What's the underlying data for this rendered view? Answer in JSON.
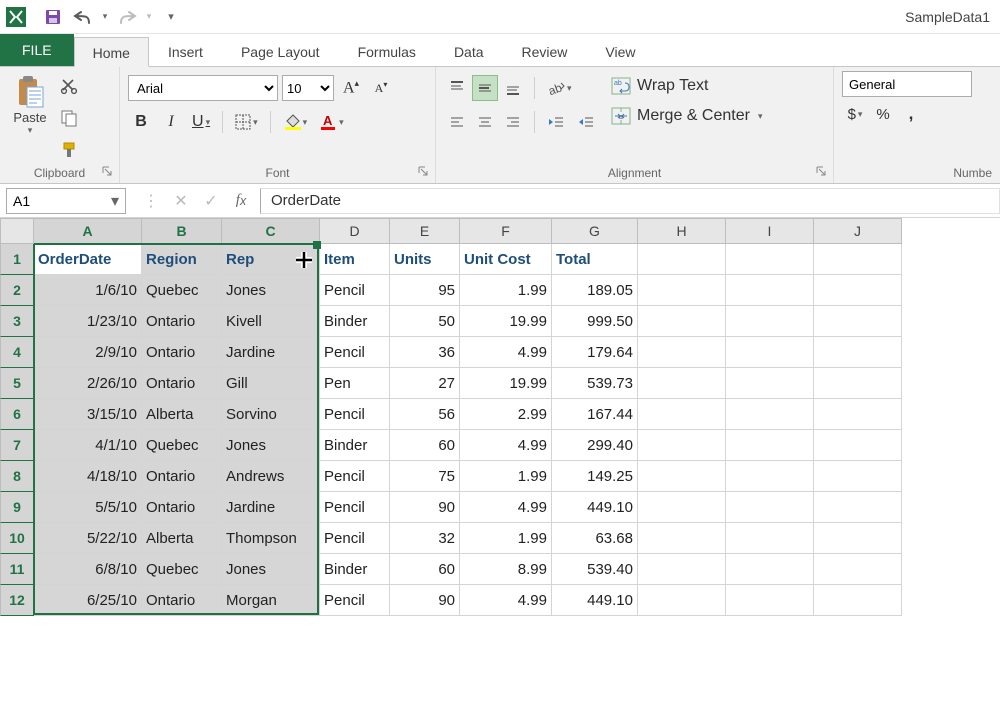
{
  "app": {
    "doc_title": "SampleData1"
  },
  "qat": {
    "save": "save-icon",
    "undo": "undo-icon",
    "redo": "redo-icon"
  },
  "tabs": {
    "file": "FILE",
    "items": [
      "Home",
      "Insert",
      "Page Layout",
      "Formulas",
      "Data",
      "Review",
      "View"
    ],
    "active": 0
  },
  "ribbon": {
    "clipboard": {
      "label": "Clipboard",
      "paste": "Paste"
    },
    "font": {
      "label": "Font",
      "name": "Arial",
      "size": "10",
      "bold": "B",
      "italic": "I",
      "underline": "U"
    },
    "alignment": {
      "label": "Alignment",
      "wrap": "Wrap Text",
      "merge": "Merge & Center"
    },
    "number": {
      "label": "Numbe",
      "format": "General",
      "currency": "$",
      "percent": "%",
      "comma": ","
    }
  },
  "fx": {
    "namebox": "A1",
    "formula": "OrderDate"
  },
  "grid": {
    "columns": [
      {
        "letter": "A",
        "w": 108
      },
      {
        "letter": "B",
        "w": 80
      },
      {
        "letter": "C",
        "w": 98
      },
      {
        "letter": "D",
        "w": 70
      },
      {
        "letter": "E",
        "w": 70
      },
      {
        "letter": "F",
        "w": 92
      },
      {
        "letter": "G",
        "w": 86
      },
      {
        "letter": "H",
        "w": 88
      },
      {
        "letter": "I",
        "w": 88
      },
      {
        "letter": "J",
        "w": 88
      }
    ],
    "selected_cols": [
      0,
      1,
      2
    ],
    "headers": [
      "OrderDate",
      "Region",
      "Rep",
      "Item",
      "Units",
      "Unit Cost",
      "Total"
    ],
    "numeric_cols": [
      0,
      4,
      5,
      6
    ],
    "rows": [
      [
        "1/6/10",
        "Quebec",
        "Jones",
        "Pencil",
        "95",
        "1.99",
        "189.05"
      ],
      [
        "1/23/10",
        "Ontario",
        "Kivell",
        "Binder",
        "50",
        "19.99",
        "999.50"
      ],
      [
        "2/9/10",
        "Ontario",
        "Jardine",
        "Pencil",
        "36",
        "4.99",
        "179.64"
      ],
      [
        "2/26/10",
        "Ontario",
        "Gill",
        "Pen",
        "27",
        "19.99",
        "539.73"
      ],
      [
        "3/15/10",
        "Alberta",
        "Sorvino",
        "Pencil",
        "56",
        "2.99",
        "167.44"
      ],
      [
        "4/1/10",
        "Quebec",
        "Jones",
        "Binder",
        "60",
        "4.99",
        "299.40"
      ],
      [
        "4/18/10",
        "Ontario",
        "Andrews",
        "Pencil",
        "75",
        "1.99",
        "149.25"
      ],
      [
        "5/5/10",
        "Ontario",
        "Jardine",
        "Pencil",
        "90",
        "4.99",
        "449.10"
      ],
      [
        "5/22/10",
        "Alberta",
        "Thompson",
        "Pencil",
        "32",
        "1.99",
        "63.68"
      ],
      [
        "6/8/10",
        "Quebec",
        "Jones",
        "Binder",
        "60",
        "8.99",
        "539.40"
      ],
      [
        "6/25/10",
        "Ontario",
        "Morgan",
        "Pencil",
        "90",
        "4.99",
        "449.10"
      ]
    ],
    "cursor_plus": {
      "row": 0,
      "col": 2
    }
  }
}
